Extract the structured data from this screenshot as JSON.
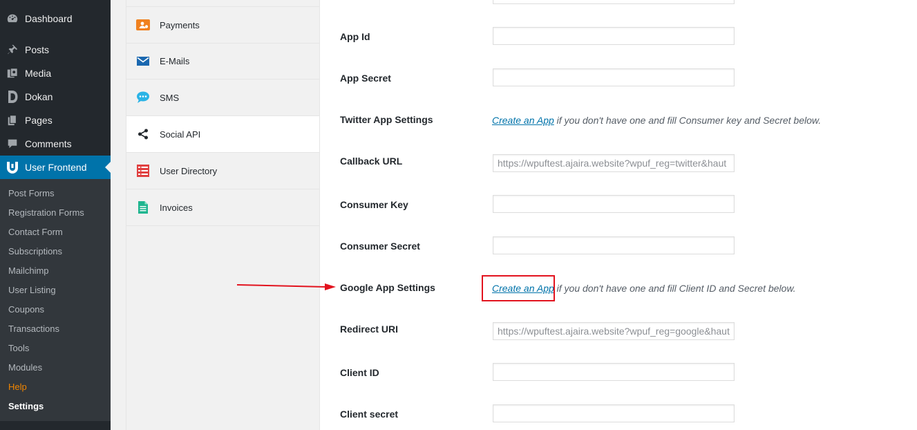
{
  "admin_menu": {
    "items": [
      {
        "label": "Dashboard",
        "icon": "dashboard-icon"
      },
      {
        "label": "Posts",
        "icon": "pin-icon"
      },
      {
        "label": "Media",
        "icon": "media-icon"
      },
      {
        "label": "Dokan",
        "icon": "dokan-icon"
      },
      {
        "label": "Pages",
        "icon": "pages-icon"
      },
      {
        "label": "Comments",
        "icon": "comments-icon"
      },
      {
        "label": "User Frontend",
        "icon": "user-frontend-icon"
      }
    ],
    "submenu": [
      "Post Forms",
      "Registration Forms",
      "Contact Form",
      "Subscriptions",
      "Mailchimp",
      "User Listing",
      "Coupons",
      "Transactions",
      "Tools",
      "Modules",
      "Help",
      "Settings"
    ]
  },
  "settings_nav": {
    "tabs": [
      {
        "label": "Payments",
        "icon": "payments-icon"
      },
      {
        "label": "E-Mails",
        "icon": "envelope-icon"
      },
      {
        "label": "SMS",
        "icon": "sms-icon"
      },
      {
        "label": "Social API",
        "icon": "share-icon"
      },
      {
        "label": "User Directory",
        "icon": "user-directory-icon"
      },
      {
        "label": "Invoices",
        "icon": "invoice-icon"
      }
    ],
    "active": "Social API"
  },
  "form": {
    "app_id": {
      "label": "App Id",
      "value": ""
    },
    "app_secret": {
      "label": "App Secret",
      "value": ""
    },
    "twitter": {
      "label": "Twitter App Settings",
      "link": "Create an App",
      "text": " if you don't have one and fill Consumer key and Secret below."
    },
    "callback_url": {
      "label": "Callback URL",
      "value": "https://wpuftest.ajaira.website?wpuf_reg=twitter&haut"
    },
    "consumer_key": {
      "label": "Consumer Key",
      "value": ""
    },
    "consumer_secret": {
      "label": "Consumer Secret",
      "value": ""
    },
    "google": {
      "label": "Google App Settings",
      "link": "Create an App",
      "text": " if you don't have one and fill Client ID and Secret below."
    },
    "redirect_uri": {
      "label": "Redirect URI",
      "value": "https://wpuftest.ajaira.website?wpuf_reg=google&haut"
    },
    "client_id": {
      "label": "Client ID",
      "value": ""
    },
    "client_secret": {
      "label": "Client secret",
      "value": ""
    }
  },
  "colors": {
    "sidebar": "#23282d",
    "submenu": "#32373c",
    "accent": "#0073aa",
    "help": "#f18500",
    "highlight": "#e2131e"
  }
}
